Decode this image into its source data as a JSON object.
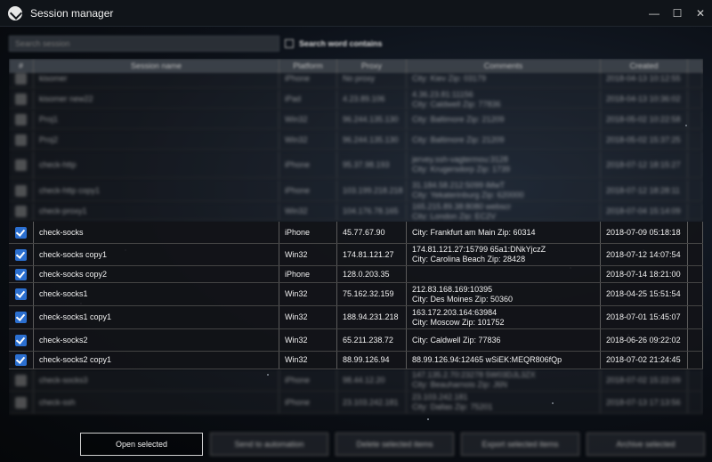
{
  "window": {
    "title": "Session manager",
    "minimize": "—",
    "maximize": "☐",
    "close": "✕"
  },
  "search": {
    "placeholder": "Search session",
    "option_label": "Search word contains"
  },
  "columns": {
    "check": "#",
    "name": "Session name",
    "platform": "Platform",
    "proxy": "Proxy",
    "comments": "Comments",
    "created": "Created"
  },
  "rows_blurred_top": [
    {
      "name": "kisomer",
      "platform": "iPhone",
      "proxy": "No proxy",
      "c1": "",
      "c2": "City: Kiev Zip: 03179",
      "date": "2018-04-13 10:12:55"
    },
    {
      "name": "kisomer new22",
      "platform": "iPad",
      "proxy": "4.23.89.106",
      "c1": "4.36.23.81:11156",
      "c2": "City: Caldwell Zip: 77836",
      "date": "2018-04-13 10:36:02"
    },
    {
      "name": "Proj1",
      "platform": "Win32",
      "proxy": "96.244.135.130",
      "c1": "",
      "c2": "City: Baltimore Zip: 21209",
      "date": "2018-05-02 10:22:58"
    },
    {
      "name": "Proj2",
      "platform": "Win32",
      "proxy": "96.244.135.130",
      "c1": "",
      "c2": "City: Baltimore Zip: 21209",
      "date": "2018-05-02 15:37:25"
    },
    {
      "name": "check-http",
      "platform": "iPhone",
      "proxy": "95.37.98.193",
      "c1": "jervey.ssh-vagtermou:3128",
      "c2": "City: Krugersdorp Zip: 1739",
      "date": "2018-07-12 18:15:27"
    },
    {
      "name": "check-http copy1",
      "platform": "iPhone",
      "proxy": "103.199.218.218",
      "c1": "31.184.58.212:5099 iMwT",
      "c2": "City: Yekaterinburg Zip: 620000",
      "date": "2018-07-12 18:28:11"
    },
    {
      "name": "check-proxy1",
      "platform": "Win32",
      "proxy": "104.176.78.165",
      "c1": "165.215.89.38:8080 webscr",
      "c2": "City: London Zip: EC2V",
      "date": "2018-07-04 15:14:09"
    }
  ],
  "rows": [
    {
      "name": "check-socks",
      "platform": "iPhone",
      "proxy": "45.77.67.90",
      "c1": "",
      "c2": "City: Frankfurt am Main Zip: 60314",
      "date": "2018-07-09 05:18:18"
    },
    {
      "name": "check-socks copy1",
      "platform": "Win32",
      "proxy": "174.81.121.27",
      "c1": "174.81.121.27:15799 65a1:DNkYjczZ",
      "c2": "City: Carolina Beach Zip: 28428",
      "date": "2018-07-12 14:07:54"
    },
    {
      "name": "check-socks copy2",
      "platform": "iPhone",
      "proxy": "128.0.203.35",
      "c1": "",
      "c2": "",
      "date": "2018-07-14 18:21:00"
    },
    {
      "name": "check-socks1",
      "platform": "Win32",
      "proxy": "75.162.32.159",
      "c1": "212.83.168.169:10395",
      "c2": "City: Des Moines Zip: 50360",
      "date": "2018-04-25 15:51:54"
    },
    {
      "name": "check-socks1 copy1",
      "platform": "Win32",
      "proxy": "188.94.231.218",
      "c1": "163.172.203.164:63984",
      "c2": "City: Moscow Zip: 101752",
      "date": "2018-07-01 15:45:07"
    },
    {
      "name": "check-socks2",
      "platform": "Win32",
      "proxy": "65.211.238.72",
      "c1": "",
      "c2": "City: Caldwell Zip: 77836",
      "date": "2018-06-26 09:22:02"
    },
    {
      "name": "check-socks2 copy1",
      "platform": "Win32",
      "proxy": "88.99.126.94",
      "c1": "88.99.126.94:12465 wSiEK:MEQR806fQp",
      "c2": "",
      "date": "2018-07-02 21:24:45"
    }
  ],
  "rows_blurred_bottom": [
    {
      "name": "check-socks3",
      "platform": "iPhone",
      "proxy": "98.44.12.20",
      "c1": "147.135.2.70:23278 5W03DJL3ZX",
      "c2": "City: Beauharnois Zip: J6N",
      "date": "2018-07-02 15:22:09"
    },
    {
      "name": "check-ssh",
      "platform": "iPhone",
      "proxy": "23.103.242.181",
      "c1": "23.103.242.181",
      "c2": "City: Dallas Zip: 75201",
      "date": "2018-07-13 17:13:56"
    }
  ],
  "buttons": {
    "open": "Open selected",
    "automation": "Send to automation",
    "delete": "Delete selected items",
    "export": "Export selected items",
    "archive": "Archive selected"
  }
}
